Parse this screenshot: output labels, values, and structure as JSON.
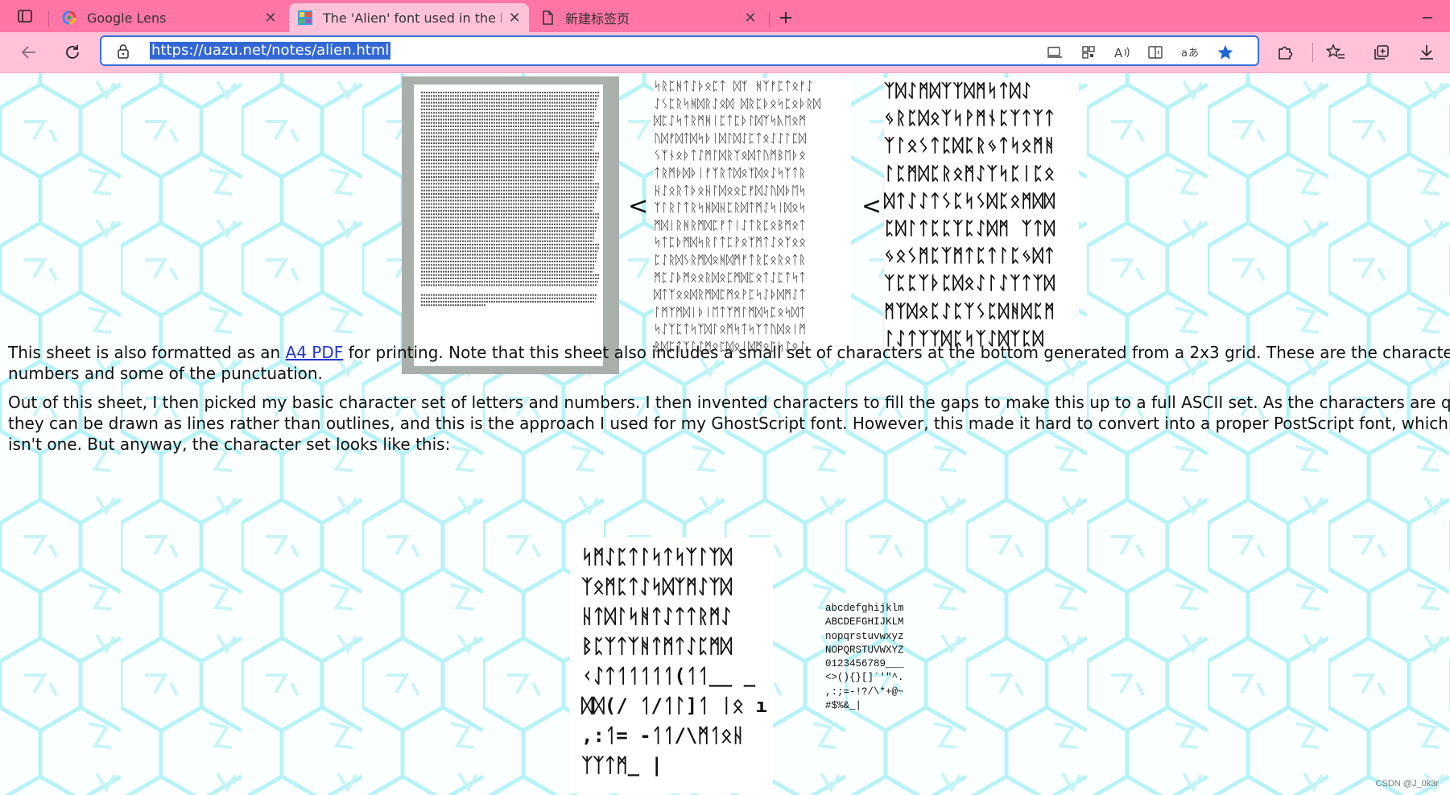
{
  "browser": {
    "tabs": [
      {
        "title": "Google Lens",
        "active": false,
        "icon": "google-lens-icon"
      },
      {
        "title": "The 'Alien' font used in the backgro",
        "active": true,
        "icon": "site-favicon-icon"
      },
      {
        "title": "新建标签页",
        "active": false,
        "icon": "page-icon"
      }
    ],
    "address_bar": {
      "url": "https://uazu.net/notes/alien.html"
    },
    "colors": {
      "tabbar": "#ff75a6",
      "toolbar": "#ffc2d8",
      "url_highlight": "#3367d6"
    }
  },
  "page": {
    "symbols": {
      "less_than": "<"
    },
    "thumb_mid_lines": [
      "ᛋᚱᛈᚻᛏᛇᚦᛟᛈᛏ ᛞᛉ ᚻᛉᚠᛈᛏᛟᚠᛇ",
      "ᛇᛊᛈᚱᛋᚻᛞᚱᛇᛟᛞ ᛞᚱᛈᚦᛟᛋᛈᛟᚦᚱᛞ",
      "ᛞᛈᛇᛋᛏᚱᛗᚻᛁᛈᛏᛈᚦᛚᛞᛉᛋᚣᛖᛟᛗ",
      "ᚢᛞᚠᛞᛏᛞᛋᚦᛁᛞᛚᛞᛇᛈᛏᛟᛇᛇᛚᛈᛞ",
      "ᛊᛉᚾᛟᚦᛏᛇᛗᛚᛞᚱᛉᛟᛞᛏᚢᛗᛒᛖᚦᛟ",
      "ᛏᚱᛗᚦᛞᚦᛁᚠᛉᚱᛏᛞᛟᛉᛞᛟᛇᛋᛉᛏᚱ",
      "ᚺᛇᛟᚱᛏᚦᛟᚺᛚᛞᛟᛟᛈᚠᛞᛇᚢᛞᚦᛖᛋ",
      "ᛉᛚᚱᛚᛏᚱᛋᚻᛞᚺᛈᚱᛞᛏᛗᛇᛋᛁᛞᛟᛋ",
      "ᛗᛞᛁᚱᚻᚱᛗᛞᛈᚠᛏᛁᛇᛏᚱᛈᛟᛒᛗᛟᛏ",
      "ᛋᛏᛈᚦᛗᛞᛋᚱᛚᛏᛈᚹᛟᛉᛗᛏᛇᛟᛉᛟᛟ",
      "ᛈᛇᚱᛞᛊᚱᛗᛞᛟᚻᛞᛗᚠᛏᚱᛈᛟᚱᛟᛏᚱ",
      "ᛗᛈᛇᚦᛗᛟᛟᚱᛞᛟᛈᛗᛞᛈᛟᛏᛇᛈᛏᛋᛏ",
      "ᛞᛏᛉᛟᛟᛞᚱᛗᛞᛈᛗᛟᚹᛈᛋᛇᚦᛞᛗᛇᛏ",
      "ᛚᛗᛉᛗᛞᛁᚦᛁᛖᛏᛉᛗᛚᛗᛞᛋᛈᛟᛋᛞᛏ",
      "ᛋᛇᛉᛈᛏᛋᛉᛞᛚᛟᛗᛋᛏᛋᛉᛏᚢᛞᛟᛁᛗ",
      "ᛒᛞᛈᛏᛉᛚᛇᛗᛟᛈᛞᛟᛁᛞᛗᛟᛈᛋᛇᛟᛇ",
      "ᛗᛞᛗᛈᛈᛋᛇᛗᛞᛟᛈᛈᛏᛁᛗᛇᛗᛉᛗᛟᛗ"
    ],
    "thumb_right_lines": [
      "ᛉᛞᛇᛗᛞᛉᛉᛞᛗᛋᛏᛞᛇ",
      "ᛃᚱᛈᛞᛟᛉᛋᚹᛗᚾᛈᛉᛏᛉᛏ",
      "ᛉᛚᛟᛊᛏᛈᛞᛈᚱᛃᛏᛋᛟᛗᚻ",
      "ᛚᛈᛗᛞᛈᚱᛟᛗᛇᛉᛋᛈᛁᛈᛟ",
      "ᛞᛏᛇᛇᛏᛊᛈᛋᛊᛞᛈᛟᛗᛞᛞ",
      "ᛈᛞᛚᛏᛈᛈᛉᛈᛇᛞᛗ ᛉᛏᛞ",
      "ᛃᛟᛊᛗᛈᛉᛗᛏᛈᛏᛚᛈᛃᛞᛏ",
      "ᛉᛈᛈᛉᚦᛈᛞᛟᛇᛚᛇᛉᛏᛉᛞ",
      "ᛗᛉᛞᛟᛈᛇᛈᛉᛊᛈᛞᚻᛞᛈᛗ",
      "ᛚᛇᛏᛉᛉᛞᛈᛋᛉᛇᛞᛉᛈᛞ"
    ],
    "para1_pre": "This sheet is also formatted as an ",
    "para1_link": "A4 PDF",
    "para1_post": " for printing. Note that this sheet also includes a small set of characters at the bottom generated from a 2x3 grid. These are the characters I used for",
    "para1_line2": "numbers and some of the punctuation.",
    "para2_lines": [
      "Out of this sheet, I then picked my basic character set of letters and numbers. I then invented characters to fill the gaps to make this up to a full ASCII set. As the characters are quite simple,",
      "they can be drawn as lines rather than outlines, and this is the approach I used for my GhostScript font. However, this made it hard to convert into a proper PostScript font, which is why there",
      "isn't one. But anyway, the character set looks like this:"
    ],
    "charset_lines": [
      "ᛋᛗᛇᛈᛏᛚᛋᛏᛋᛉᛚᛉᛞ",
      "ᛉᛟᛗᛈᛏᛇᛋᛞᛉᛗᛇᛉᛞ",
      "ᚺᛏᛞᛚᛋᚻᛏᛇᛏᛏᚱᛗᛇ",
      "ᛒᛈᛉᛏᛉᚻᛏᛗᛏᛇᛈᛗᛞ",
      "ᚲᛇᛏᛐᛐᛐᛐᛐ(ᛐᛐ__ _",
      "ᛞᛞ(/ ᛐ/ᛐᛚ]ᛐ ᛁᛟ ı",
      ",:ᛐ= -ᛐᛐ/\\ᛗᛐᛟᚺ",
      "ᛉᛉᛏᛗ_ |"
    ],
    "ascii_lines": [
      "abcdefghijklm",
      "ABCDEFGHIJKLM",
      "nopqrstuvwxyz",
      "NOPQRSTUVWXYZ",
      "0123456789___",
      "<>(){}[]`'\"^.",
      ",:;=-!?/\\*+@~",
      "#$%&_|"
    ],
    "watermark": "CSDN @J_0k3r",
    "background_colors": {
      "base": "#fbffff",
      "hex_lines": "#b7f3f6",
      "glyph": "#c8f4f6"
    }
  }
}
